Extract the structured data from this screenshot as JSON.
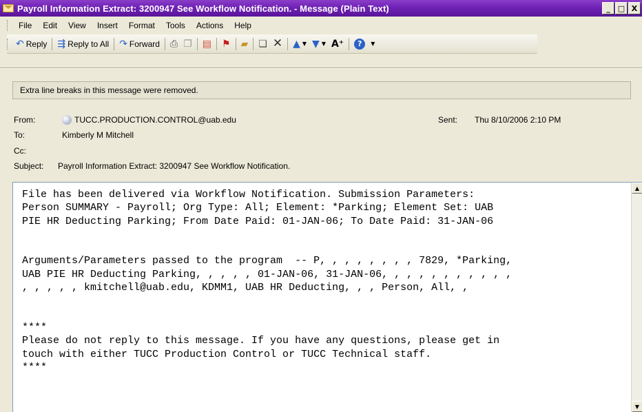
{
  "window": {
    "title": "Payroll Information Extract: 3200947 See Workflow Notification. - Message (Plain Text)",
    "minimize": "_",
    "maximize": "□",
    "close": "X"
  },
  "menu": [
    "File",
    "Edit",
    "View",
    "Insert",
    "Format",
    "Tools",
    "Actions",
    "Help"
  ],
  "toolbar": {
    "reply": "Reply",
    "reply_all": "Reply to All",
    "forward": "Forward"
  },
  "infobar": "Extra line breaks in this message were removed.",
  "header": {
    "from_label": "From:",
    "from": "TUCC.PRODUCTION.CONTROL@uab.edu",
    "sent_label": "Sent:",
    "sent": "Thu 8/10/2006 2:10 PM",
    "to_label": "To:",
    "to": "Kimberly M Mitchell",
    "cc_label": "Cc:",
    "cc": "",
    "subject_label": "Subject:",
    "subject": "Payroll Information Extract: 3200947 See Workflow Notification."
  },
  "body": "File has been delivered via Workflow Notification. Submission Parameters:\nPerson SUMMARY - Payroll; Org Type: All; Element: *Parking; Element Set: UAB\nPIE HR Deducting Parking; From Date Paid: 01-JAN-06; To Date Paid: 31-JAN-06\n\n\nArguments/Parameters passed to the program  -- P, , , , , , , , 7829, *Parking,\nUAB PIE HR Deducting Parking, , , , , 01-JAN-06, 31-JAN-06, , , , , , , , , , ,\n, , , , , kmitchell@uab.edu, KDMM1, UAB HR Deducting, , , Person, All, ,\n\n\n****\nPlease do not reply to this message. If you have any questions, please get in\ntouch with either TUCC Production Control or TUCC Technical staff.\n****"
}
